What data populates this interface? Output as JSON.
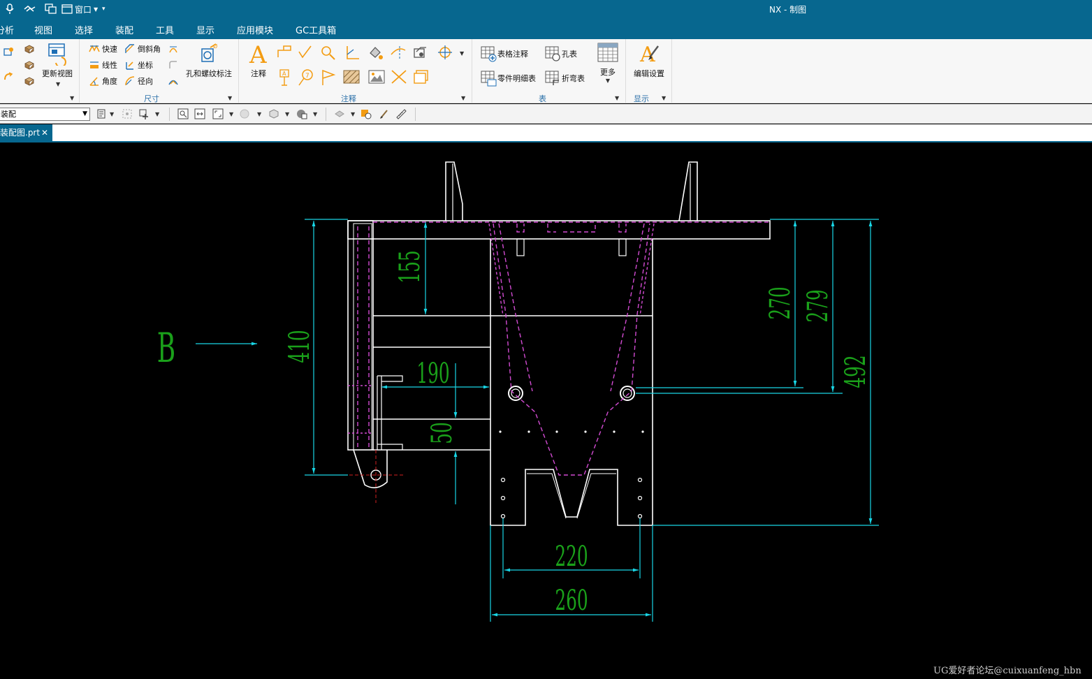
{
  "app": {
    "title": "NX - 制图",
    "quick_access": {
      "window_label": "窗口"
    }
  },
  "menu": [
    "分析",
    "视图",
    "选择",
    "装配",
    "工具",
    "显示",
    "应用模块",
    "GC工具箱"
  ],
  "ribbon": {
    "view_group": {
      "update_view": "更新视图"
    },
    "dimension_group": {
      "label": "尺寸",
      "quick": "快速",
      "linear": "线性",
      "angle": "角度",
      "chamfer": "倒斜角",
      "coordinate": "坐标",
      "radial": "径向",
      "hole_thread": "孔和螺纹标注"
    },
    "annotation_group": {
      "label": "注释",
      "note": "注释"
    },
    "table_group": {
      "label": "表",
      "tabular_note": "表格注释",
      "hole_table": "孔表",
      "parts_list": "零件明细表",
      "bend_table": "折弯表",
      "more": "更多"
    },
    "display_group": {
      "label": "显示",
      "edit_settings": "编辑设置"
    }
  },
  "toolbar": {
    "selection_filter": "装配"
  },
  "tab": {
    "label": "装配图.prt",
    "close": "✕"
  },
  "drawing": {
    "view_label": "B",
    "dimensions": {
      "d155": "155",
      "d410": "410",
      "d190": "190",
      "d50": "50",
      "d270": "270",
      "d279": "279",
      "d492": "492",
      "d220": "220",
      "d260": "260"
    },
    "colors": {
      "geometry": "#ffffff",
      "hidden": "#d24bd2",
      "dimension_line": "#19d6e6",
      "dimension_text": "#1aa01a",
      "centerline": "#d02020"
    }
  },
  "watermark": "UG爱好者论坛@cuixuanfeng_hbn"
}
